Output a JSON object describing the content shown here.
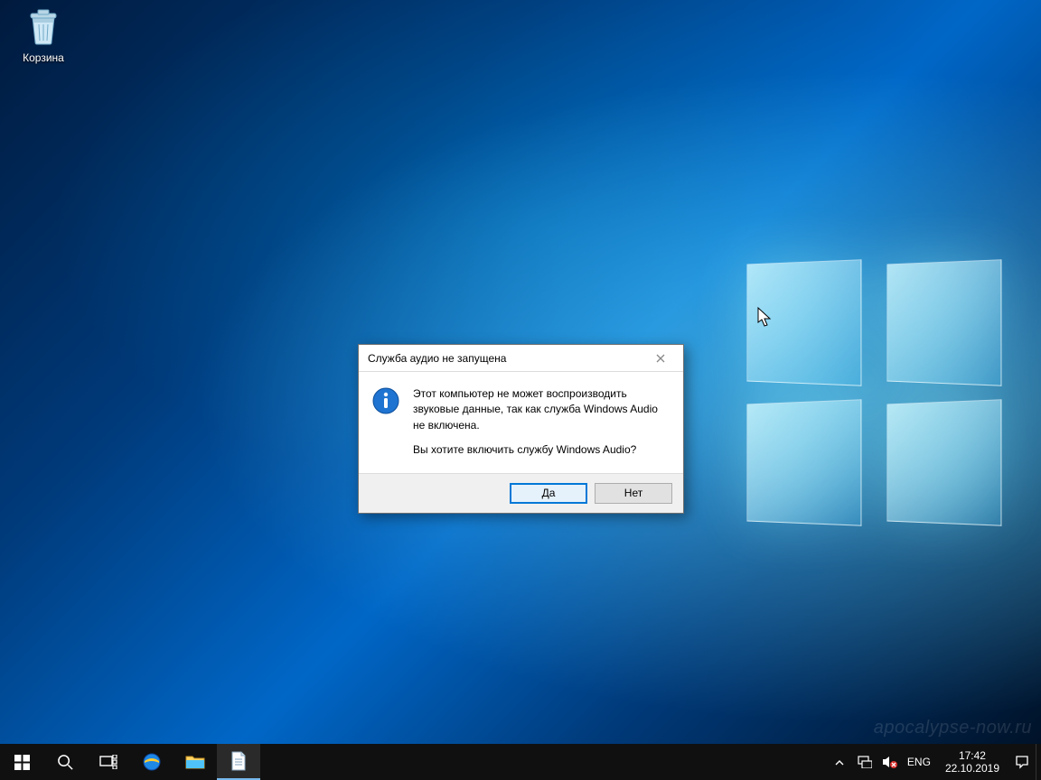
{
  "desktop": {
    "icons": [
      {
        "name": "recycle-bin",
        "label": "Корзина"
      }
    ],
    "watermark": "apocalypse-now.ru"
  },
  "dialog": {
    "title": "Служба аудио не запущена",
    "message_line1": "Этот компьютер не может воспроизводить звуковые данные, так как служба Windows Audio не включена.",
    "message_line2": "Вы хотите включить службу Windows Audio?",
    "yes": "Да",
    "no": "Нет"
  },
  "taskbar": {
    "language": "ENG",
    "time": "17:42",
    "date": "22.10.2019"
  }
}
